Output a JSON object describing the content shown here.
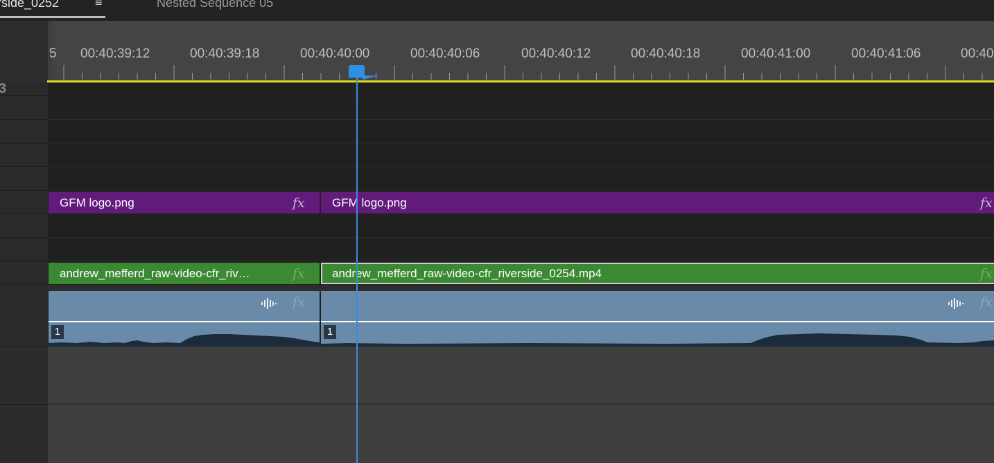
{
  "tabs": {
    "active_label": "rside_0252",
    "menu_icon": "≡",
    "second_label": "Nested Sequence 05"
  },
  "ruler": {
    "edge_fragment": "5",
    "timecodes": [
      "00:40:39:12",
      "00:40:39:18",
      "00:40:40:00",
      "00:40:40:06",
      "00:40:40:12",
      "00:40:40:18",
      "00:40:41:00",
      "00:40:41:06",
      "00:40"
    ]
  },
  "headers": {
    "glyph": "3"
  },
  "clips": {
    "graphic_1": {
      "name": "GFM logo.png",
      "fx": "fx"
    },
    "graphic_2": {
      "name": "GFM logo.png",
      "fx": "fx"
    },
    "video_1": {
      "name": "andrew_mefferd_raw-video-cfr_riv…",
      "fx": "fx"
    },
    "video_2": {
      "name": "andrew_mefferd_raw-video-cfr_riverside_0254.mp4",
      "fx": "fx"
    },
    "audio_1": {
      "channel": "1",
      "fx": "fx"
    },
    "audio_2": {
      "channel": "1",
      "fx": "fx"
    }
  },
  "colors": {
    "graphic_clip": "#621a7b",
    "video_clip": "#3b8a33",
    "audio_clip": "#6a8aaa",
    "playhead": "#2f8ee6",
    "work_area_bar": "#e4da1c"
  },
  "icons": {
    "playhead": "playhead-icon",
    "waveform": "waveform-icon",
    "fx_badge": "fx-icon"
  }
}
